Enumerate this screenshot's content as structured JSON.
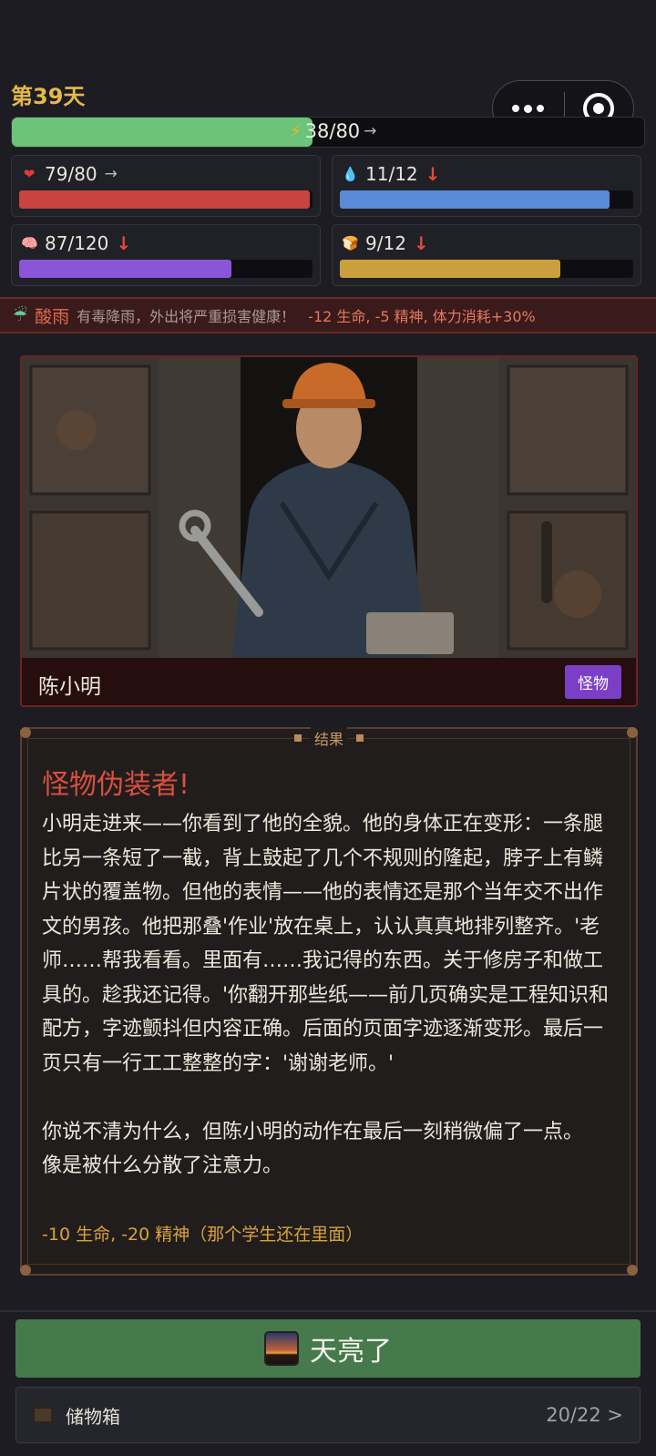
{
  "day": {
    "label": "第39天"
  },
  "energy": {
    "text": "38/80",
    "trend": "→",
    "fraction": 0.475,
    "color": "#6cc47a"
  },
  "stats": [
    {
      "icon": "❤",
      "icon_name": "heart-icon",
      "value": "79/80",
      "trend": "→",
      "trend_type": "flat",
      "fraction": 0.99,
      "color": "#c94440"
    },
    {
      "icon": "💧",
      "icon_name": "water-drop-icon",
      "value": "11/12",
      "trend": "↓",
      "trend_type": "down",
      "fraction": 0.92,
      "color": "#5b8ad8"
    },
    {
      "icon": "🧠",
      "icon_name": "brain-icon",
      "value": "87/120",
      "trend": "↓",
      "trend_type": "down",
      "fraction": 0.725,
      "color": "#8a55d8"
    },
    {
      "icon": "🍞",
      "icon_name": "bread-icon",
      "value": "9/12",
      "trend": "↓",
      "trend_type": "down",
      "fraction": 0.75,
      "color": "#c9a03c"
    }
  ],
  "weather": {
    "icon": "acid-rain-icon",
    "name": "酸雨",
    "desc": "有毒降雨，外出将严重损害健康！",
    "effect": "-12 生命, -5 精神, 体力消耗+30%"
  },
  "character": {
    "name": "陈小明",
    "tag": "怪物"
  },
  "result": {
    "header": "结果",
    "title": "怪物伪装者!",
    "body": "小明走进来——你看到了他的全貌。他的身体正在变形：一条腿比另一条短了一截，背上鼓起了几个不规则的隆起，脖子上有鳞片状的覆盖物。但他的表情——他的表情还是那个当年交不出作文的男孩。他把那叠'作业'放在桌上，认认真真地排列整齐。'老师……帮我看看。里面有……我记得的东西。关于修房子和做工具的。趁我还记得。'你翻开那些纸——前几页确实是工程知识和配方，字迹颤抖但内容正确。后面的页面字迹逐渐变形。最后一页只有一行工工整整的字：'谢谢老师。'\n\n你说不清为什么，但陈小明的动作在最后一刻稍微偏了一点。\n像是被什么分散了注意力。",
    "effect": "-10 生命, -20 精神（那个学生还在里面）"
  },
  "action": {
    "label": "天亮了"
  },
  "storage": {
    "label": "储物箱",
    "count": "20/22 >"
  }
}
